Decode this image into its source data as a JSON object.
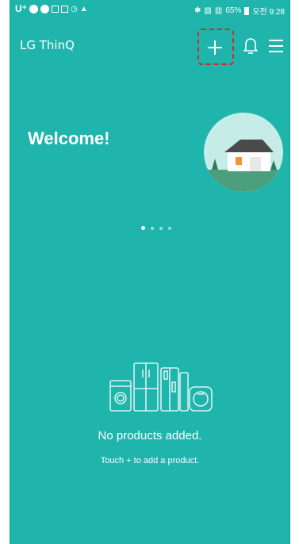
{
  "status_bar": {
    "carrier": "U⁺",
    "signal_text": "65%",
    "time": "오전 9:28"
  },
  "app_bar": {
    "title": "LG ThinQ",
    "add_icon": "plus-icon",
    "notification_icon": "bell-icon",
    "menu_icon": "hamburger-menu-icon"
  },
  "hero": {
    "welcome": "Welcome!",
    "illustration": "house-icon",
    "pager": {
      "count": 4,
      "active_index": 0
    }
  },
  "empty_state": {
    "illustration": "appliances-icon",
    "title": "No products added.",
    "hint": "Touch + to add a product."
  },
  "colors": {
    "background": "#1fb5ac",
    "highlight": "#d9262c",
    "text": "#ffffff"
  }
}
